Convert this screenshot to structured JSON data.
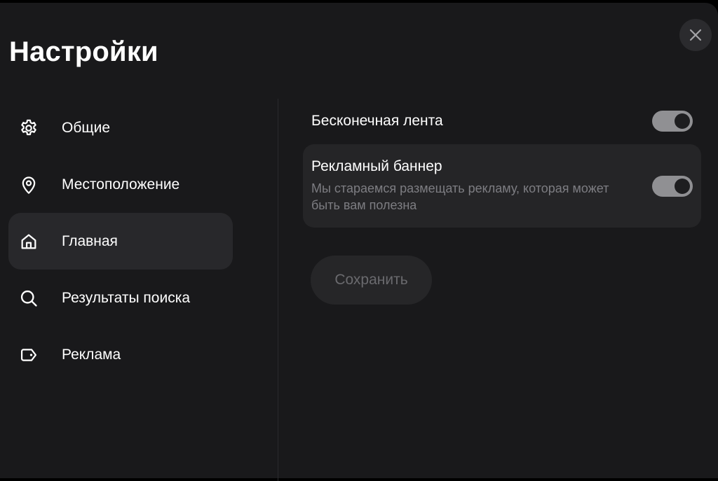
{
  "header": {
    "title": "Настройки",
    "close_icon": "close-icon"
  },
  "sidebar": {
    "active_index": 2,
    "items": [
      {
        "label": "Общие",
        "icon": "gear-icon"
      },
      {
        "label": "Местоположение",
        "icon": "location-pin-icon"
      },
      {
        "label": "Главная",
        "icon": "home-icon"
      },
      {
        "label": "Результаты поиска",
        "icon": "search-icon"
      },
      {
        "label": "Реклама",
        "icon": "ad-tag-icon"
      }
    ]
  },
  "main": {
    "settings": [
      {
        "title": "Бесконечная лента",
        "enabled": true
      },
      {
        "title": "Рекламный баннер",
        "description": "Мы стараемся размещать рекламу, которая может быть вам полезна",
        "enabled": true
      }
    ],
    "save_label": "Сохранить",
    "save_enabled": false
  },
  "colors": {
    "background": "#19191b",
    "active_item": "#28282b",
    "card": "#252527",
    "toggle_on": "#909093",
    "text_primary": "#ffffff",
    "text_secondary": "#7d7d82"
  }
}
